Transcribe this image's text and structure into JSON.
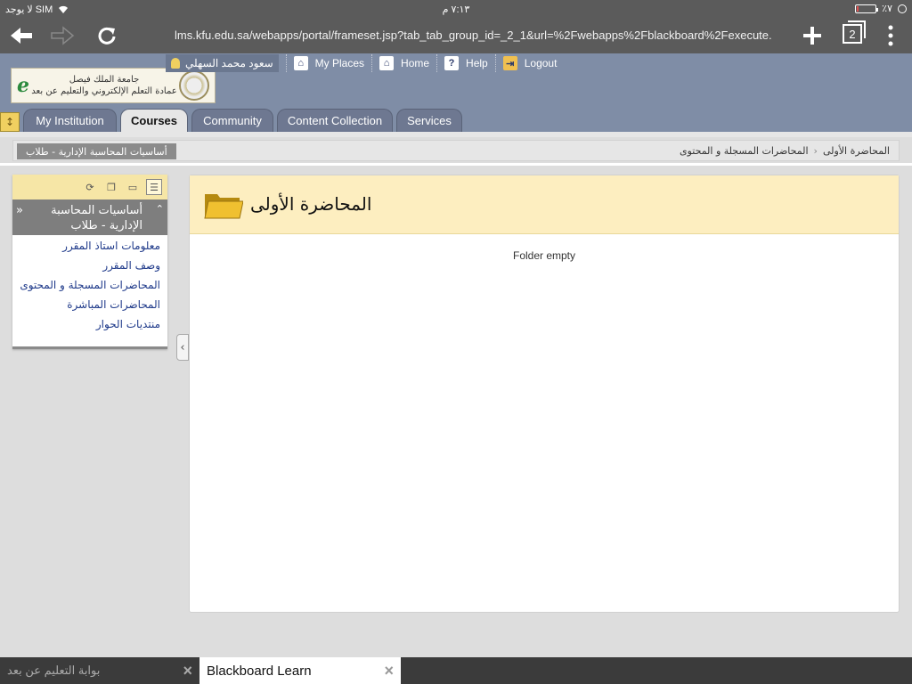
{
  "status": {
    "carrier": "لا يوجد SIM",
    "time": "٧:١٣ م",
    "battery": "٪٧",
    "battery_level": 0.07
  },
  "browser": {
    "url": "lms.kfu.edu.sa/webapps/portal/frameset.jsp?tab_tab_group_id=_2_1&url=%2Fwebapps%2Fblackboard%2Fexecute...",
    "tab_count": "2"
  },
  "header": {
    "logo_line1": "جامعة الملك فيصل",
    "logo_line2": "عمادة التعلم الإلكتروني والتعليم عن بعد",
    "user_name": "سعود محمد السهلي",
    "links": [
      {
        "label": "My Places",
        "icon": "places-icon"
      },
      {
        "label": "Home",
        "icon": "home-icon"
      },
      {
        "label": "Help",
        "icon": "help-icon"
      },
      {
        "label": "Logout",
        "icon": "logout-icon"
      }
    ]
  },
  "tabs": [
    {
      "label": "My Institution",
      "active": false
    },
    {
      "label": "Courses",
      "active": true
    },
    {
      "label": "Community",
      "active": false
    },
    {
      "label": "Content Collection",
      "active": false
    },
    {
      "label": "Services",
      "active": false
    }
  ],
  "breadcrumb": {
    "course": "أساسيات المحاسبة الإدارية - طلاب",
    "items": [
      "المحاضرات المسجلة و المحتوى",
      "المحاضرة الأولى"
    ],
    "separator": "‹"
  },
  "course_menu": {
    "title": "أساسيات المحاسبة الإدارية - طلاب",
    "items": [
      "معلومات استاذ المقرر",
      "وصف المقرر",
      "المحاضرات المسجلة و المحتوى",
      "المحاضرات المباشرة",
      "منتديات الحوار"
    ]
  },
  "content": {
    "title": "المحاضرة الأولى",
    "empty_message": "Folder empty"
  },
  "bottom_tabs": [
    {
      "label": "بوابة التعليم عن بعد",
      "active": false
    },
    {
      "label": "Blackboard Learn",
      "active": true
    }
  ],
  "colors": {
    "header_bg": "#7f8da6",
    "content_header_bg": "#fdeec0",
    "link": "#1f3a8a"
  }
}
